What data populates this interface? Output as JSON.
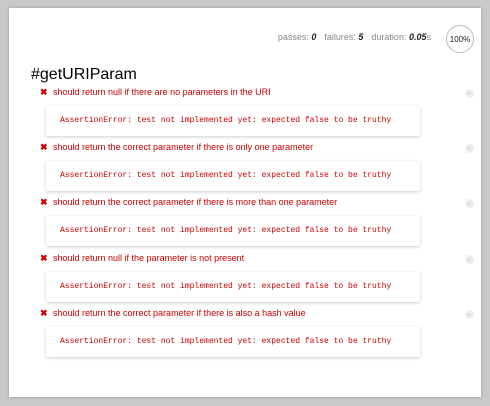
{
  "stats": {
    "passes_label": "passes:",
    "passes": "0",
    "failures_label": "failures:",
    "failures": "5",
    "duration_label": "duration:",
    "duration": "0.05",
    "duration_unit": "s",
    "progress": "100%"
  },
  "suite": {
    "title": "#getURIParam"
  },
  "tests": [
    {
      "title": "should return null if there are no parameters in the URI",
      "error": "AssertionError: test not implemented yet: expected false to be truthy",
      "status_icon": "x-icon"
    },
    {
      "title": "should return the correct parameter if there is only one parameter",
      "error": "AssertionError: test not implemented yet: expected false to be truthy",
      "status_icon": "x-icon"
    },
    {
      "title": "should return the correct parameter if there is more than one parameter",
      "error": "AssertionError: test not implemented yet: expected false to be truthy",
      "status_icon": "x-icon"
    },
    {
      "title": "should return null if the parameter is not present",
      "error": "AssertionError: test not implemented yet: expected false to be truthy",
      "status_icon": "x-icon"
    },
    {
      "title": "should return the correct parameter if there is also a hash value",
      "error": "AssertionError: test not implemented yet: expected false to be truthy",
      "status_icon": "x-icon"
    }
  ],
  "colors": {
    "fail": "#cc0000",
    "text": "#222222",
    "muted": "#888888"
  }
}
